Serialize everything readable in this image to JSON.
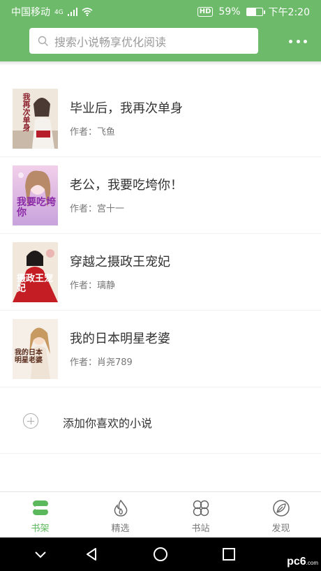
{
  "status_bar": {
    "carrier": "中国移动",
    "network": "4G",
    "hd": "HD",
    "battery_percent": "59%",
    "battery_level": 0.59,
    "time": "下午2:20"
  },
  "header": {
    "search_placeholder": "搜索小说畅享优化阅读",
    "more_icon": "more-dots-icon"
  },
  "colors": {
    "brand_green": "#6dbb6a",
    "active_tab": "#5cb85c"
  },
  "books": [
    {
      "title": "毕业后，我再次单身",
      "author": "作者：飞鱼",
      "cover_text": "我再次单身"
    },
    {
      "title": "老公，我要吃垮你！",
      "author": "作者：宫十一",
      "cover_text": "我要吃垮你"
    },
    {
      "title": "穿越之摄政王宠妃",
      "author": "作者：璃静",
      "cover_text": "摄政王宠妃"
    },
    {
      "title": "我的日本明星老婆",
      "author": "作者：肖尧789",
      "cover_text": "我的日本明星老婆"
    }
  ],
  "add_row": {
    "label": "添加你喜欢的小说"
  },
  "tabs": [
    {
      "label": "书架",
      "icon": "bookshelf-icon",
      "active": true
    },
    {
      "label": "精选",
      "icon": "flame-icon",
      "active": false
    },
    {
      "label": "书站",
      "icon": "clover-icon",
      "active": false
    },
    {
      "label": "发现",
      "icon": "leaf-icon",
      "active": false
    }
  ],
  "nav_bar": {
    "watermark": "pc6",
    "watermark_suffix": ".com"
  }
}
